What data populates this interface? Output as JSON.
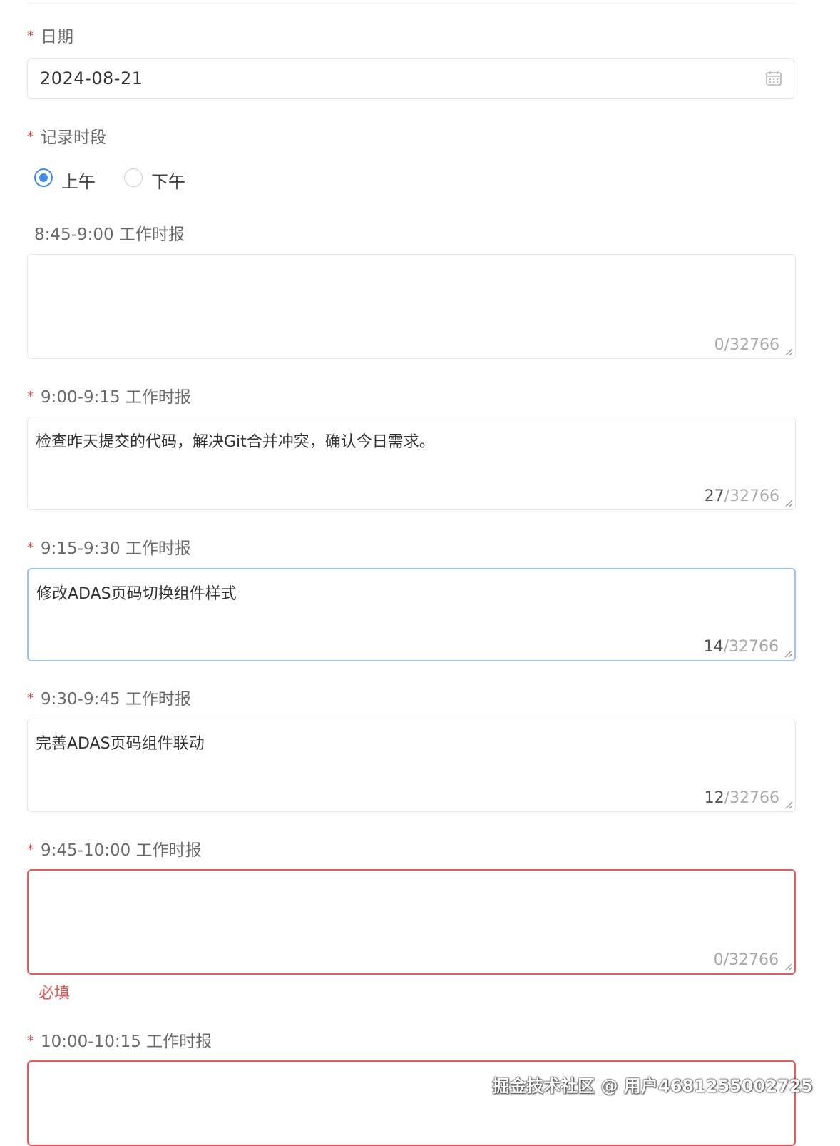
{
  "date_field": {
    "required": true,
    "label": "日期",
    "value": "2024-08-21",
    "icon": "calendar-icon"
  },
  "period_field": {
    "required": true,
    "label": "记录时段",
    "options": [
      {
        "label": "上午",
        "checked": true
      },
      {
        "label": "下午",
        "checked": false
      }
    ]
  },
  "reports": [
    {
      "required": false,
      "label": "8:45-9:00 工作时报",
      "value": "",
      "count": "0",
      "max": "/32766",
      "state": "normal"
    },
    {
      "required": true,
      "label": "9:00-9:15 工作时报",
      "value": "检查昨天提交的代码，解决Git合并冲突，确认今日需求。",
      "count": "27",
      "max": "/32766",
      "state": "normal"
    },
    {
      "required": true,
      "label": "9:15-9:30 工作时报",
      "value": "修改ADAS页码切换组件样式",
      "count": "14",
      "max": "/32766",
      "state": "focused"
    },
    {
      "required": true,
      "label": "9:30-9:45 工作时报",
      "value": "完善ADAS页码组件联动",
      "count": "12",
      "max": "/32766",
      "state": "normal"
    },
    {
      "required": true,
      "label": "9:45-10:00 工作时报",
      "value": "",
      "count": "0",
      "max": "/32766",
      "state": "error",
      "error": "必填"
    },
    {
      "required": true,
      "label": "10:00-10:15 工作时报",
      "value": "",
      "count": "",
      "max": "",
      "state": "error"
    }
  ],
  "required_marker": "*",
  "colors": {
    "accent": "#3d8ee8",
    "error": "#e35b5b",
    "required_star": "#e24d4d",
    "focus_border": "#9cc3ec"
  },
  "watermark": "掘金技术社区 @ 用户4681255002725"
}
